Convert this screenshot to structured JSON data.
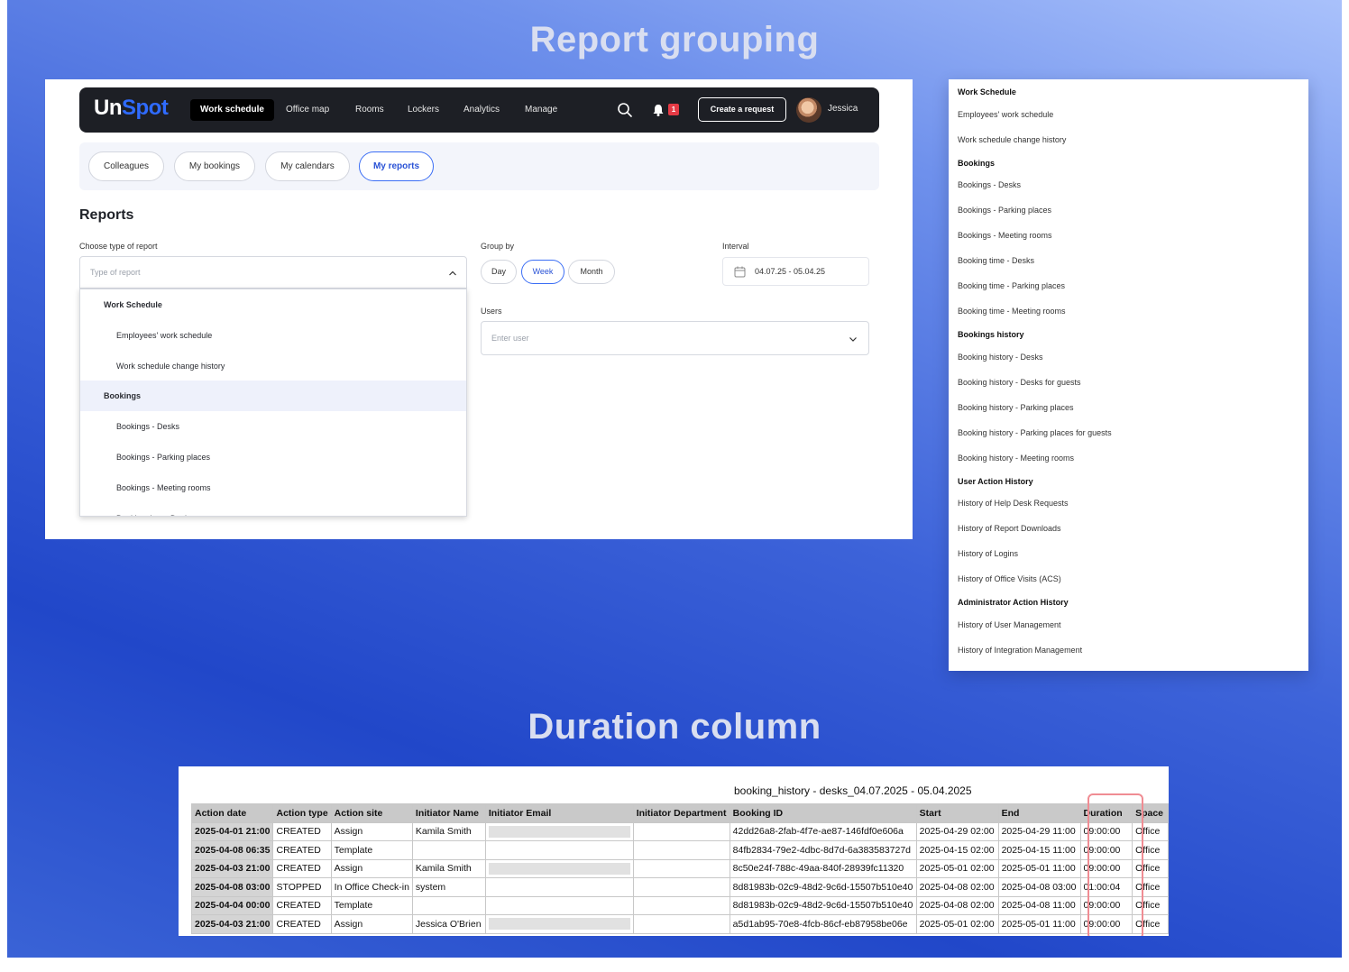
{
  "titles": {
    "grouping": "Report grouping",
    "duration": "Duration column"
  },
  "app": {
    "logo_un": "Un",
    "logo_spot": "Spot",
    "nav": [
      "Work schedule",
      "Office map",
      "Rooms",
      "Lockers",
      "Analytics",
      "Manage"
    ],
    "notification_count": "1",
    "create_request": "Create a request",
    "user_name": "Jessica",
    "tabs": [
      "Colleagues",
      "My bookings",
      "My calendars",
      "My reports"
    ],
    "active_tab": "My reports",
    "heading": "Reports",
    "type_label": "Choose type of report",
    "type_placeholder": "Type of report",
    "dropdown": [
      {
        "kind": "group",
        "label": "Work Schedule"
      },
      {
        "kind": "opt",
        "label": "Employees' work schedule"
      },
      {
        "kind": "opt",
        "label": "Work schedule change history"
      },
      {
        "kind": "group",
        "label": "Bookings",
        "highlighted": true
      },
      {
        "kind": "opt",
        "label": "Bookings - Desks"
      },
      {
        "kind": "opt",
        "label": "Bookings - Parking places"
      },
      {
        "kind": "opt",
        "label": "Bookings - Meeting rooms"
      },
      {
        "kind": "opt",
        "label": "Booking time - Desks"
      }
    ],
    "group_by_label": "Group by",
    "group_by_options": [
      "Day",
      "Week",
      "Month"
    ],
    "group_by_selected": "Week",
    "interval_label": "Interval",
    "interval_value": "04.07.25 - 05.04.25",
    "users_label": "Users",
    "users_placeholder": "Enter user",
    "accent_color": "#3b6ef5"
  },
  "report_list": [
    {
      "kind": "group",
      "label": "Work Schedule"
    },
    {
      "kind": "opt",
      "label": "Employees' work schedule"
    },
    {
      "kind": "opt",
      "label": "Work schedule change history"
    },
    {
      "kind": "group",
      "label": "Bookings"
    },
    {
      "kind": "opt",
      "label": "Bookings - Desks"
    },
    {
      "kind": "opt",
      "label": "Bookings - Parking places"
    },
    {
      "kind": "opt",
      "label": "Bookings - Meeting rooms"
    },
    {
      "kind": "opt",
      "label": "Booking time - Desks"
    },
    {
      "kind": "opt",
      "label": "Booking time - Parking places"
    },
    {
      "kind": "opt",
      "label": "Booking time - Meeting rooms"
    },
    {
      "kind": "group",
      "label": "Bookings history"
    },
    {
      "kind": "opt",
      "label": "Booking history - Desks"
    },
    {
      "kind": "opt",
      "label": "Booking history - Desks for guests"
    },
    {
      "kind": "opt",
      "label": "Booking history - Parking places"
    },
    {
      "kind": "opt",
      "label": "Booking history - Parking places for guests"
    },
    {
      "kind": "opt",
      "label": "Booking history - Meeting rooms"
    },
    {
      "kind": "group",
      "label": "User Action History"
    },
    {
      "kind": "opt",
      "label": "History of Help Desk Requests"
    },
    {
      "kind": "opt",
      "label": "History of Report Downloads"
    },
    {
      "kind": "opt",
      "label": "History of Logins"
    },
    {
      "kind": "opt",
      "label": "History of Office Visits (ACS)"
    },
    {
      "kind": "group",
      "label": "Administrator Action History"
    },
    {
      "kind": "opt",
      "label": "History of User Management"
    },
    {
      "kind": "opt",
      "label": "History of Integration Management"
    }
  ],
  "sheet": {
    "title": "booking_history - desks_04.07.2025 - 05.04.2025",
    "columns": [
      "Action date",
      "Action type",
      "Action site",
      "Initiator Name",
      "Initiator Email",
      "Initiator Department",
      "Booking ID",
      "Start",
      "End",
      "Duration",
      "Space"
    ],
    "rows": [
      [
        "2025-04-01 21:00",
        "CREATED",
        "Assign",
        "Kamila Smith",
        "",
        "",
        "42dd26a8-2fab-4f7e-ae87-146fdf0e606a",
        "2025-04-29 02:00",
        "2025-04-29 11:00",
        "09:00:00",
        "Office"
      ],
      [
        "2025-04-08 06:35",
        "CREATED",
        "Template",
        "",
        "",
        "",
        "84fb2834-79e2-4dbc-8d7d-6a383583727d",
        "2025-04-15 02:00",
        "2025-04-15 11:00",
        "09:00:00",
        "Office"
      ],
      [
        "2025-04-03 21:00",
        "CREATED",
        "Assign",
        "Kamila Smith",
        "",
        "",
        "8c50e24f-788c-49aa-840f-28939fc11320",
        "2025-05-01 02:00",
        "2025-05-01 11:00",
        "09:00:00",
        "Office"
      ],
      [
        "2025-04-08 03:00",
        "STOPPED",
        "In Office Check-in",
        "system",
        "",
        "",
        "8d81983b-02c9-48d2-9c6d-15507b510e40",
        "2025-04-08 02:00",
        "2025-04-08 03:00",
        "01:00:04",
        "Office"
      ],
      [
        "2025-04-04 00:00",
        "CREATED",
        "Template",
        "",
        "",
        "",
        "8d81983b-02c9-48d2-9c6d-15507b510e40",
        "2025-04-08 02:00",
        "2025-04-08 11:00",
        "09:00:00",
        "Office"
      ],
      [
        "2025-04-03 21:00",
        "CREATED",
        "Assign",
        "Jessica O'Brien",
        "",
        "",
        "a5d1ab95-70e8-4fcb-86cf-eb87958be06e",
        "2025-05-01 02:00",
        "2025-05-01 11:00",
        "09:00:00",
        "Office"
      ]
    ],
    "email_redacted_rows": [
      0,
      2,
      5
    ],
    "highlight_column": "Duration",
    "highlight_color": "#f08c93"
  }
}
